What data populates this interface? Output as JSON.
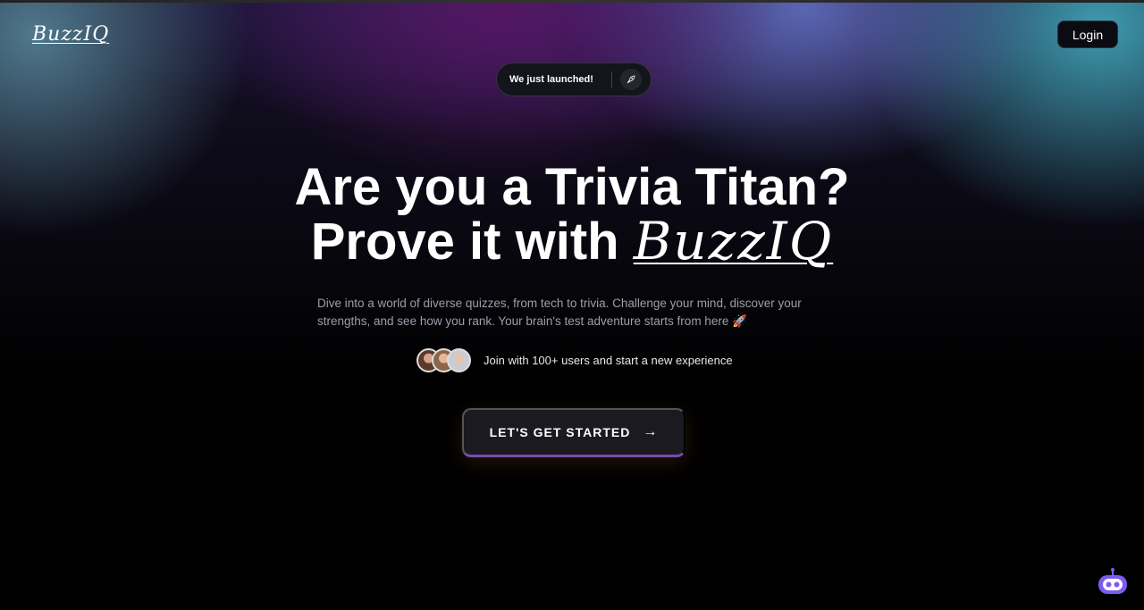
{
  "header": {
    "logo": "BuzzIQ",
    "login_label": "Login"
  },
  "badge": {
    "text": "We just launched!",
    "icon": "rocket-icon"
  },
  "hero": {
    "title_line1": "Are you a Trivia Titan?",
    "title_line2_prefix": "Prove it with ",
    "title_brand": "BuzzIQ",
    "subtitle": "Dive into a world of diverse quizzes, from tech to trivia. Challenge your mind, discover your strengths, and see how you rank. Your brain's test adventure starts from here 🚀",
    "users_text": "Join with 100+ users and start a new experience",
    "cta_label": "LET'S GET STARTED",
    "cta_icon": "→"
  },
  "chatbot": {
    "icon": "robot-icon",
    "color": "#7b5cf0"
  }
}
